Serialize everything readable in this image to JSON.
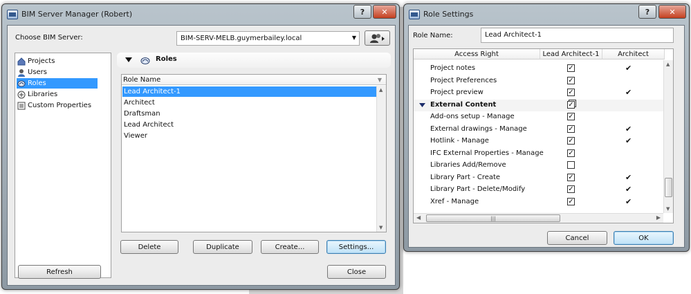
{
  "bim_manager": {
    "title": "BIM Server Manager (Robert)",
    "help_glyph": "?",
    "close_glyph": "✕",
    "choose_label": "Choose BIM Server:",
    "server_value": "BIM-SERV-MELB.guymerbailey.local",
    "dropdown_glyph": "▼",
    "nav_items": [
      {
        "label": "Projects",
        "icon": "projects-icon"
      },
      {
        "label": "Users",
        "icon": "users-icon"
      },
      {
        "label": "Roles",
        "icon": "roles-icon"
      },
      {
        "label": "Libraries",
        "icon": "libraries-icon"
      },
      {
        "label": "Custom Properties",
        "icon": "custom-properties-icon"
      }
    ],
    "section_title": "Roles",
    "list_header": "Role Name",
    "roles": [
      "Lead Architect-1",
      "Architect",
      "Draftsman",
      "Lead Architect",
      "Viewer"
    ],
    "buttons": {
      "delete": "Delete",
      "duplicate": "Duplicate",
      "create": "Create...",
      "settings": "Settings...",
      "refresh": "Refresh",
      "close": "Close"
    }
  },
  "role_settings": {
    "title": "Role Settings",
    "help_glyph": "?",
    "close_glyph": "✕",
    "role_name_label": "Role Name:",
    "role_name_value": "Lead Architect-1",
    "columns": [
      "Access Right",
      "Lead Architect-1",
      "Architect"
    ],
    "rows": [
      {
        "label": "Project notes",
        "checked": true,
        "architect": true,
        "group": false
      },
      {
        "label": "Project Preferences",
        "checked": true,
        "architect": false,
        "group": false
      },
      {
        "label": "Project preview",
        "checked": true,
        "architect": true,
        "group": false
      },
      {
        "label": "External Content",
        "checked": true,
        "architect": false,
        "group": true
      },
      {
        "label": "Add-ons setup - Manage",
        "checked": true,
        "architect": false,
        "group": false
      },
      {
        "label": "External drawings - Manage",
        "checked": true,
        "architect": true,
        "group": false
      },
      {
        "label": "Hotlink - Manage",
        "checked": true,
        "architect": true,
        "group": false
      },
      {
        "label": "IFC External Properties - Manage",
        "checked": true,
        "architect": false,
        "group": false
      },
      {
        "label": "Libraries Add/Remove",
        "checked": false,
        "architect": false,
        "group": false
      },
      {
        "label": "Library Part - Create",
        "checked": true,
        "architect": true,
        "group": false
      },
      {
        "label": "Library Part - Delete/Modify",
        "checked": true,
        "architect": true,
        "group": false
      },
      {
        "label": "Xref - Manage",
        "checked": true,
        "architect": true,
        "group": false
      }
    ],
    "check_glyph": "✓",
    "tick_glyph": "✔",
    "scroll_grip": "|||",
    "buttons": {
      "cancel": "Cancel",
      "ok": "OK"
    }
  },
  "colors": {
    "selection": "#3399ff",
    "focus_border": "#3c7fb1",
    "close_red": "#c4401f"
  }
}
